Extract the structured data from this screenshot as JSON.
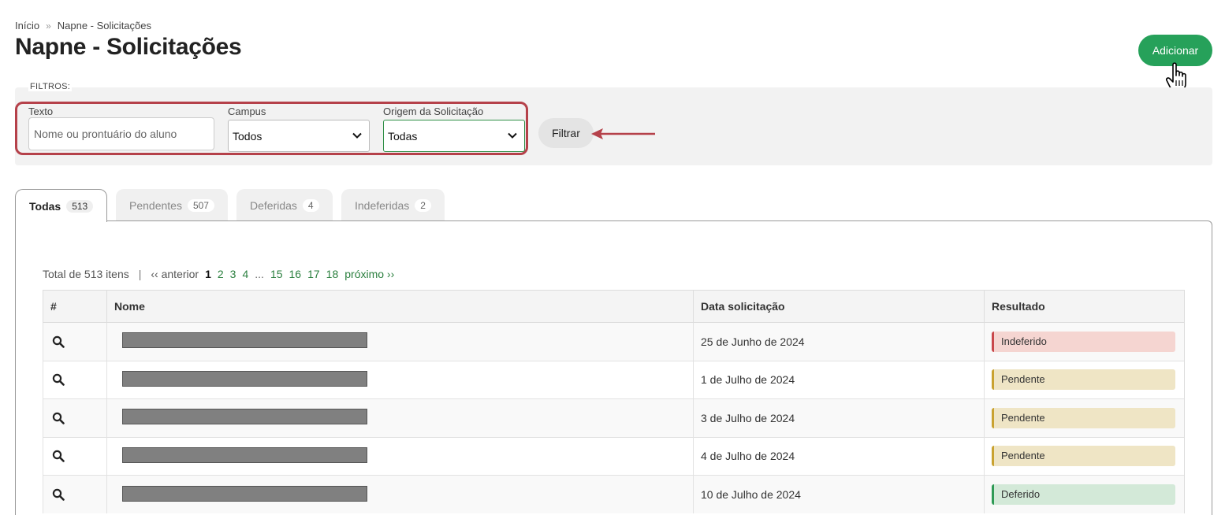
{
  "breadcrumb": {
    "home": "Início",
    "current": "Napne - Solicitações"
  },
  "page": {
    "title": "Napne - Solicitações",
    "add_button": "Adicionar"
  },
  "filters": {
    "section_label": "FILTROS:",
    "text_label": "Texto",
    "text_placeholder": "Nome ou prontuário do aluno",
    "campus_label": "Campus",
    "campus_value": "Todos",
    "origin_label": "Origem da Solicitação",
    "origin_value": "Todas",
    "filter_button": "Filtrar"
  },
  "tabs": [
    {
      "label": "Todas",
      "count": "513"
    },
    {
      "label": "Pendentes",
      "count": "507"
    },
    {
      "label": "Deferidas",
      "count": "4"
    },
    {
      "label": "Indeferidas",
      "count": "2"
    }
  ],
  "pagination": {
    "total_text": "Total de 513 itens",
    "separator": "|",
    "prev": "‹‹ anterior",
    "pages": [
      "1",
      "2",
      "3",
      "4",
      "...",
      "15",
      "16",
      "17",
      "18"
    ],
    "next": "próximo ››"
  },
  "table": {
    "headers": [
      "#",
      "Nome",
      "Data solicitação",
      "Resultado"
    ],
    "rows": [
      {
        "date": "25 de Junho de 2024",
        "result": "Indeferido"
      },
      {
        "date": "1 de Julho de 2024",
        "result": "Pendente"
      },
      {
        "date": "3 de Julho de 2024",
        "result": "Pendente"
      },
      {
        "date": "4 de Julho de 2024",
        "result": "Pendente"
      },
      {
        "date": "10 de Julho de 2024",
        "result": "Deferido"
      }
    ]
  },
  "colors": {
    "primary_green": "#26a15a",
    "highlight_red": "#b5414a",
    "link_green": "#2a7f3e",
    "status_indeferido": "#f5d5d1",
    "status_pendente": "#efe5c5",
    "status_deferido": "#d3e9d8"
  },
  "icons": [
    "search-icon",
    "chevron-down-icon",
    "hand-cursor-icon",
    "arrow-left-icon",
    "breadcrumb-separator-icon"
  ]
}
